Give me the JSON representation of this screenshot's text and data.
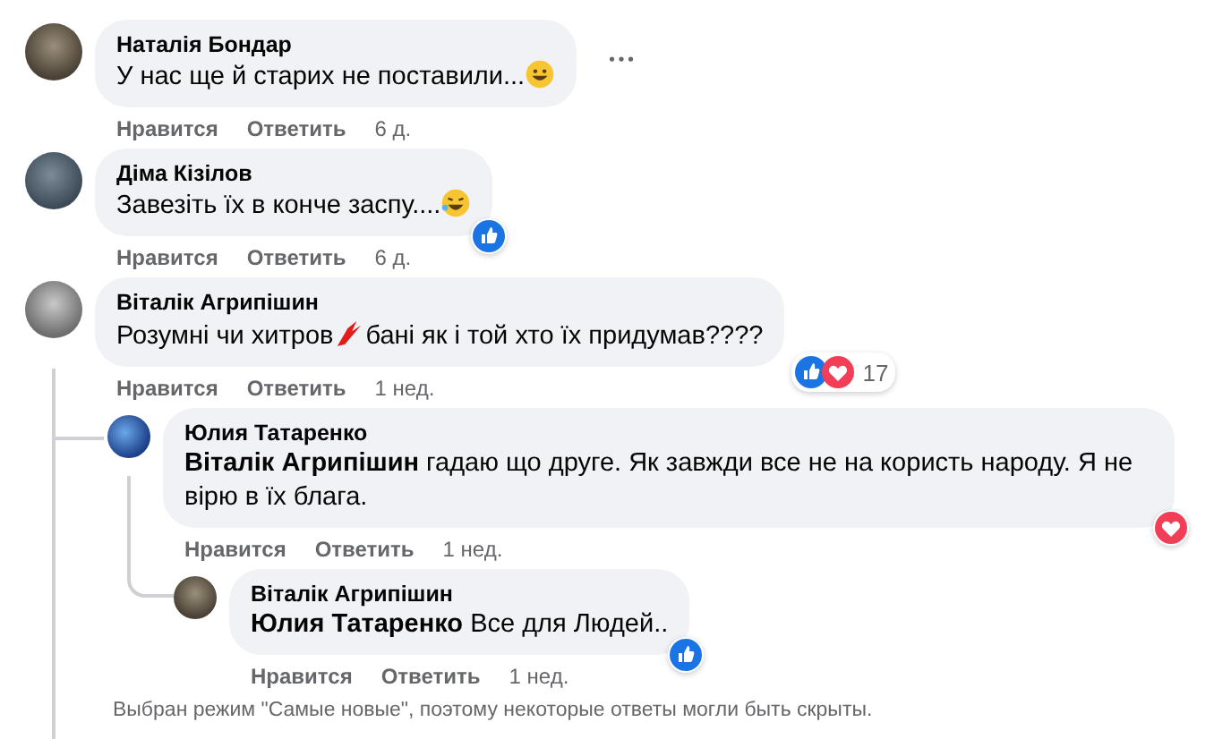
{
  "comments": [
    {
      "author": "Наталія Бондар",
      "segments": [
        {
          "kind": "text",
          "text": "У нас ще й старих не поставили..."
        },
        {
          "kind": "smile"
        }
      ],
      "more_button": true,
      "like_label": "Нравится",
      "reply_label": "Ответить",
      "time": "6 д."
    },
    {
      "author": "Діма Кізілов",
      "segments": [
        {
          "kind": "text",
          "text": "Завезіть їх в конче заспу...."
        },
        {
          "kind": "laugh"
        }
      ],
      "like_label": "Нравится",
      "reply_label": "Ответить",
      "time": "6 д.",
      "like_reaction": true
    },
    {
      "author": "Віталік Агрипішин",
      "segments": [
        {
          "kind": "text",
          "text": "Розумні чи хитров"
        },
        {
          "kind": "scribble"
        },
        {
          "kind": "text",
          "text": "бані як і той хто їх придумав????"
        }
      ],
      "like_label": "Нравится",
      "reply_label": "Ответить",
      "time": "1 нед.",
      "like_reaction": true,
      "heart_reaction": true,
      "reaction_count": "17",
      "children": [
        {
          "author": "Юлия Татаренко",
          "segments": [
            {
              "kind": "text",
              "text": "**Віталік Агрипішин** гадаю що друге. Як завжди все не на користь народу. Я не вірю в їх блага."
            }
          ],
          "like_label": "Нравится",
          "reply_label": "Ответить",
          "time": "1 нед.",
          "heart_reaction": true,
          "children": [
            {
              "author": "Віталік Агрипішин",
              "segments": [
                {
                  "kind": "text",
                  "text": "**Юлия Татаренко** Все для Людей.."
                }
              ],
              "like_label": "Нравится",
              "reply_label": "Ответить",
              "time": "1 нед.",
              "like_reaction": true
            }
          ]
        }
      ],
      "footer": "Выбран режим \"Самые новые\", поэтому некоторые ответы могли быть скрыты."
    }
  ]
}
